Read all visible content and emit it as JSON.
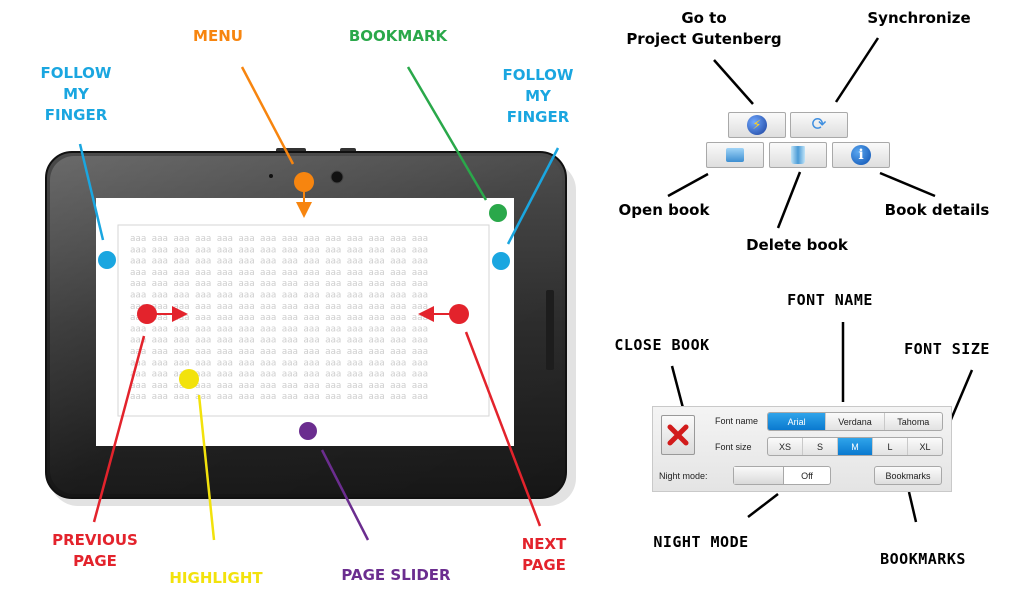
{
  "callouts": {
    "menu": "MENU",
    "bookmark": "BOOKMARK",
    "follow_left": "FOLLOW\nMY\nFINGER",
    "follow_right": "FOLLOW\nMY\nFINGER",
    "previous_page": "PREVIOUS\nPAGE",
    "highlight": "HIGHLIGHT",
    "page_slider": "PAGE SLIDER",
    "next_page": "NEXT\nPAGE"
  },
  "toolbar": {
    "go_to_gutenberg": "Go to\nProject Gutenberg",
    "synchronize": "Synchronize",
    "open_book": "Open book",
    "delete_book": "Delete book",
    "book_details": "Book details"
  },
  "settings": {
    "close_book": "CLOSE BOOK",
    "font_name_caption": "FONT NAME",
    "font_size_caption": "FONT SIZE",
    "night_mode_caption": "NIGHT MODE",
    "bookmarks_caption": "BOOKMARKS",
    "font_name_label": "Font name",
    "font_size_label": "Font size",
    "night_mode_label": "Night mode:",
    "fonts": [
      "Arial",
      "Verdana",
      "Tahoma"
    ],
    "selected_font": "Arial",
    "sizes": [
      "XS",
      "S",
      "M",
      "L",
      "XL"
    ],
    "selected_size": "M",
    "night_mode_value": "Off",
    "bookmarks_button": "Bookmarks"
  },
  "page_text": "aaa",
  "colors": {
    "menu": "#f7850f",
    "bookmark": "#2aa84a",
    "follow": "#1aa6e0",
    "page_nav": "#e3232c",
    "highlight": "#f2e20c",
    "page_slider": "#6b2d8f",
    "selected": "#0a7fd6"
  }
}
